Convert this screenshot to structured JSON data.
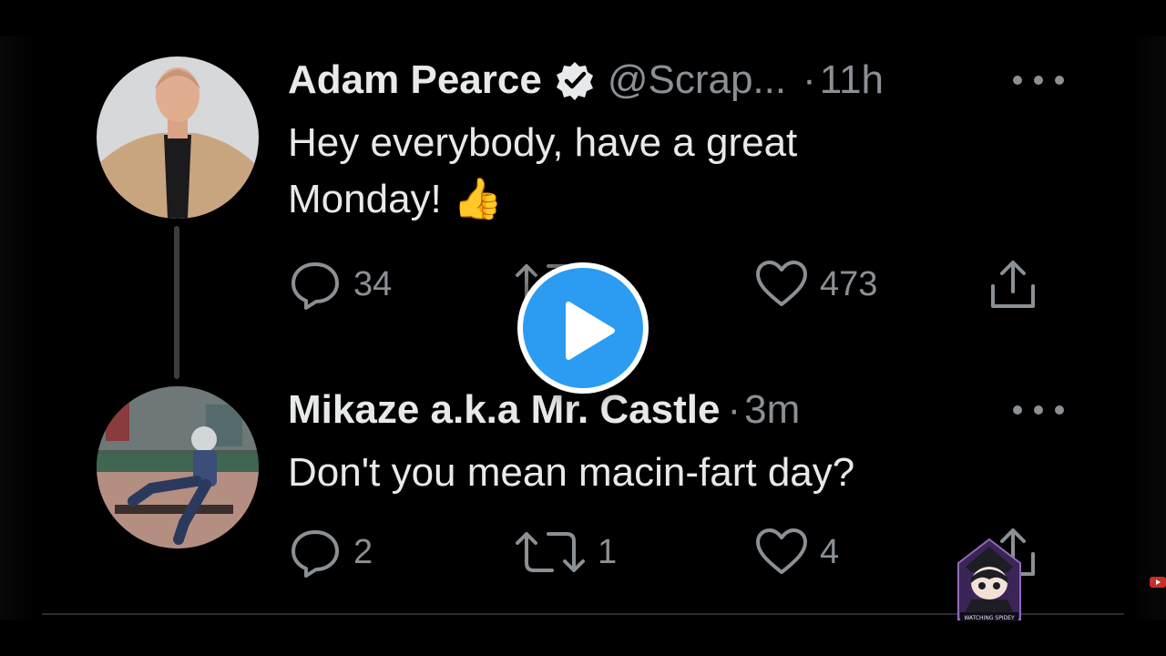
{
  "tweets": [
    {
      "name": "Adam Pearce",
      "verified": true,
      "handle": "@Scrap...",
      "dot": "·",
      "time": "11h",
      "text_line1": "Hey everybody, have a great",
      "text_line2": "Monday! 👍",
      "replies": "34",
      "retweets": "",
      "likes": "473",
      "avatar_icon": "person-in-tan-blazer-avatar"
    },
    {
      "name": "Mikaze a.k.a Mr. Castle",
      "verified": false,
      "handle": "",
      "dot": "·",
      "time": "3m",
      "text_line1": "Don't you mean macin-fart day?",
      "replies": "2",
      "retweets": "1",
      "likes": "4",
      "avatar_icon": "person-on-bench-avatar"
    }
  ],
  "overlay": {
    "play_icon": "play-icon",
    "watermark_icon": "anime-character-watermark",
    "watermark_text": "WATCHING SPIDEY"
  },
  "colors": {
    "background": "#000000",
    "text": "#e7e9ea",
    "secondary": "#8b9095",
    "play": "#2b9cf2"
  }
}
